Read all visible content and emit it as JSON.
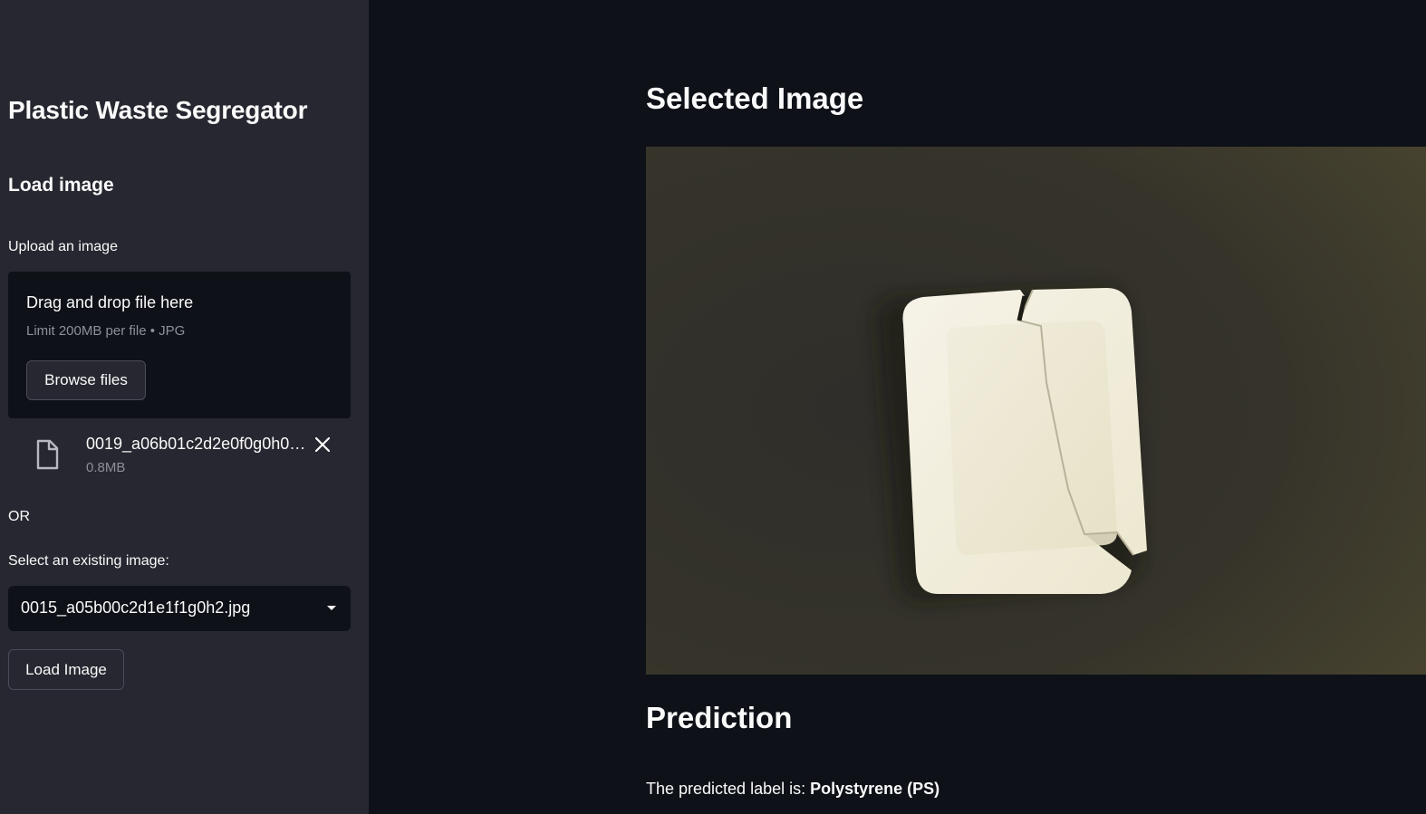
{
  "sidebar": {
    "app_title": "Plastic Waste Segregator",
    "section_title": "Load image",
    "upload_label": "Upload an image",
    "dropzone": {
      "title": "Drag and drop file here",
      "limit": "Limit 200MB per file • JPG",
      "browse_label": "Browse files"
    },
    "uploaded_file": {
      "name": "0019_a06b01c2d2e0f0g0h0…",
      "size": "0.8MB",
      "icon": "file-icon",
      "remove_icon": "close-icon"
    },
    "or_label": "OR",
    "select_label": "Select an existing image:",
    "select_value": "0015_a05b00c2d1e1f1g0h2.jpg",
    "load_button": "Load Image"
  },
  "main": {
    "selected_title": "Selected Image",
    "prediction_title": "Prediction",
    "prediction_prefix": "The predicted label is: ",
    "prediction_label": "Polystyrene (PS)"
  },
  "colors": {
    "background": "#0e1117",
    "sidebar": "#262730",
    "text": "#fafafa",
    "muted": "#8e9099"
  }
}
